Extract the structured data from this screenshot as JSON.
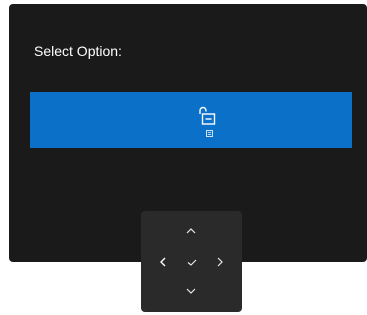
{
  "osd": {
    "title": "Select Option:",
    "accent_color": "#0a70c8",
    "panel_color": "#1a1a1a",
    "option": {
      "icon": "unlock-icon",
      "sub_icon": "menu-icon",
      "selected": true
    }
  },
  "nav_pad": {
    "up": "chevron-up-icon",
    "down": "chevron-down-icon",
    "left": "chevron-left-icon",
    "right": "chevron-right-icon",
    "ok": "checkmark-icon"
  }
}
